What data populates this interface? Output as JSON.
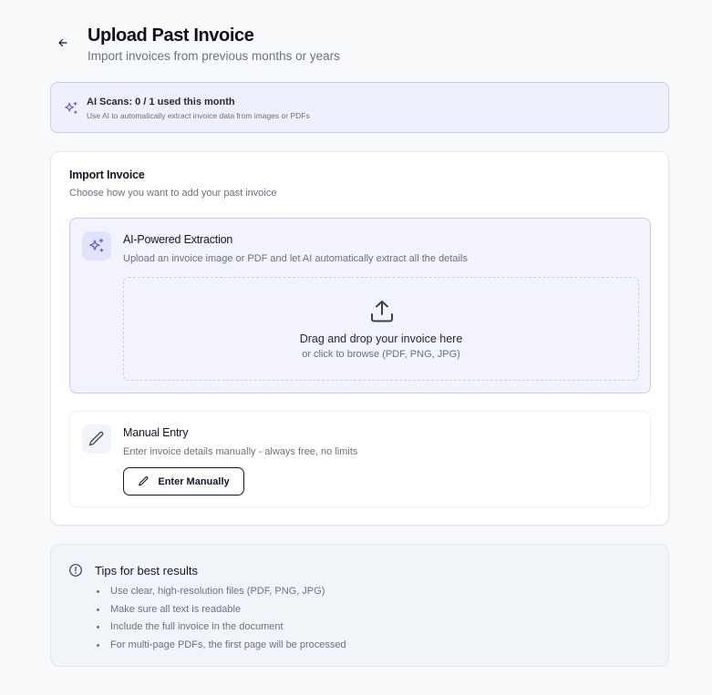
{
  "header": {
    "title": "Upload Past Invoice",
    "subtitle": "Import invoices from previous months or years",
    "back_icon": "arrow-left-icon"
  },
  "ai_scans": {
    "icon": "sparkles-icon",
    "status": "AI Scans: 0 / 1 used this month",
    "description": "Use AI to automatically extract invoice data from images or PDFs",
    "used": 0,
    "limit": 1
  },
  "import_card": {
    "title": "Import Invoice",
    "subtitle": "Choose how you want to add your past invoice",
    "ai_option": {
      "icon": "sparkles-icon",
      "title": "AI-Powered Extraction",
      "description": "Upload an invoice image or PDF and let AI automatically extract all the details",
      "dropzone": {
        "icon": "upload-icon",
        "title": "Drag and drop your invoice here",
        "subtitle": "or click to browse (PDF, PNG, JPG)"
      }
    },
    "manual_option": {
      "icon": "pencil-icon",
      "title": "Manual Entry",
      "description": "Enter invoice details manually - always free, no limits",
      "button_label": "Enter Manually"
    }
  },
  "tips": {
    "icon": "info-icon",
    "title": "Tips for best results",
    "items": [
      "Use clear, high-resolution files (PDF, PNG, JPG)",
      "Make sure all text is readable",
      "Include the full invoice in the document",
      "For multi-page PDFs, the first page will be processed"
    ]
  },
  "colors": {
    "accent": "#5b5bd6",
    "accent_bg": "#eef0fb",
    "text": "#111827",
    "muted": "#6b7280"
  }
}
